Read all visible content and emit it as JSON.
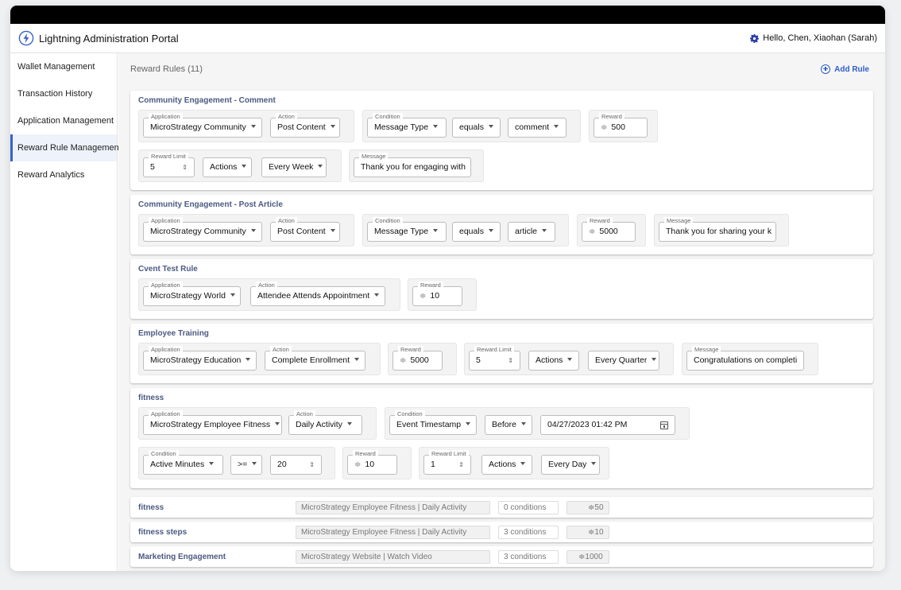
{
  "app": {
    "title": "Lightning Administration Portal",
    "user_greeting": "Hello, Chen, Xiaohan (Sarah)"
  },
  "sidebar": {
    "items": [
      {
        "label": "Wallet Management"
      },
      {
        "label": "Transaction History"
      },
      {
        "label": "Application Management"
      },
      {
        "label": "Reward Rule Management",
        "active": true
      },
      {
        "label": "Reward Analytics"
      }
    ]
  },
  "main": {
    "header": "Reward Rules (11)",
    "add_rule": "Add Rule"
  },
  "labels": {
    "application": "Application",
    "action": "Action",
    "condition": "Condition",
    "reward": "Reward",
    "reward_limit": "Reward Limit",
    "message": "Message"
  },
  "currency_symbol": "≑",
  "rules": [
    {
      "title": "Community Engagement - Comment",
      "application": "MicroStrategy Community",
      "action": "Post Content",
      "condition_field": "Message Type",
      "condition_op": "equals",
      "condition_value": "comment",
      "reward": "500",
      "reward_limit": "5",
      "limit_unit": "Actions",
      "limit_period": "Every Week",
      "message": "Thank you for engaging with"
    },
    {
      "title": "Community Engagement - Post Article",
      "application": "MicroStrategy Community",
      "action": "Post Content",
      "condition_field": "Message Type",
      "condition_op": "equals",
      "condition_value": "article",
      "reward": "5000",
      "message": "Thank you for sharing your k"
    },
    {
      "title": "Cvent Test Rule",
      "application": "MicroStrategy World",
      "action": "Attendee Attends Appointment",
      "reward": "10"
    },
    {
      "title": "Employee Training",
      "application": "MicroStrategy Education",
      "action": "Complete Enrollment",
      "reward": "5000",
      "reward_limit": "5",
      "limit_unit": "Actions",
      "limit_period": "Every Quarter",
      "message": "Congratulations on completi"
    },
    {
      "title": "fitness",
      "application": "MicroStrategy Employee Fitness",
      "action": "Daily Activity",
      "condition1_field": "Event Timestamp",
      "condition1_op": "Before",
      "condition1_value": "04/27/2023 01:42 PM",
      "condition2_field": "Active Minutes",
      "condition2_op": ">=",
      "condition2_value": "20",
      "reward": "10",
      "reward_limit": "1",
      "limit_unit": "Actions",
      "limit_period": "Every Day"
    }
  ],
  "collapsed_rules": [
    {
      "title": "fitness",
      "app_action": "MicroStrategy Employee Fitness | Daily Activity",
      "conditions": "0 conditions",
      "reward": "≑50"
    },
    {
      "title": "fitness steps",
      "app_action": "MicroStrategy Employee Fitness | Daily Activity",
      "conditions": "3 conditions",
      "reward": "≑10"
    },
    {
      "title": "Marketing Engagement",
      "app_action": "MicroStrategy Website | Watch Video",
      "conditions": "3 conditions",
      "reward": "≑1000"
    }
  ],
  "colors": {
    "accent": "#2e5fc9",
    "title_text": "#4c5a82"
  }
}
